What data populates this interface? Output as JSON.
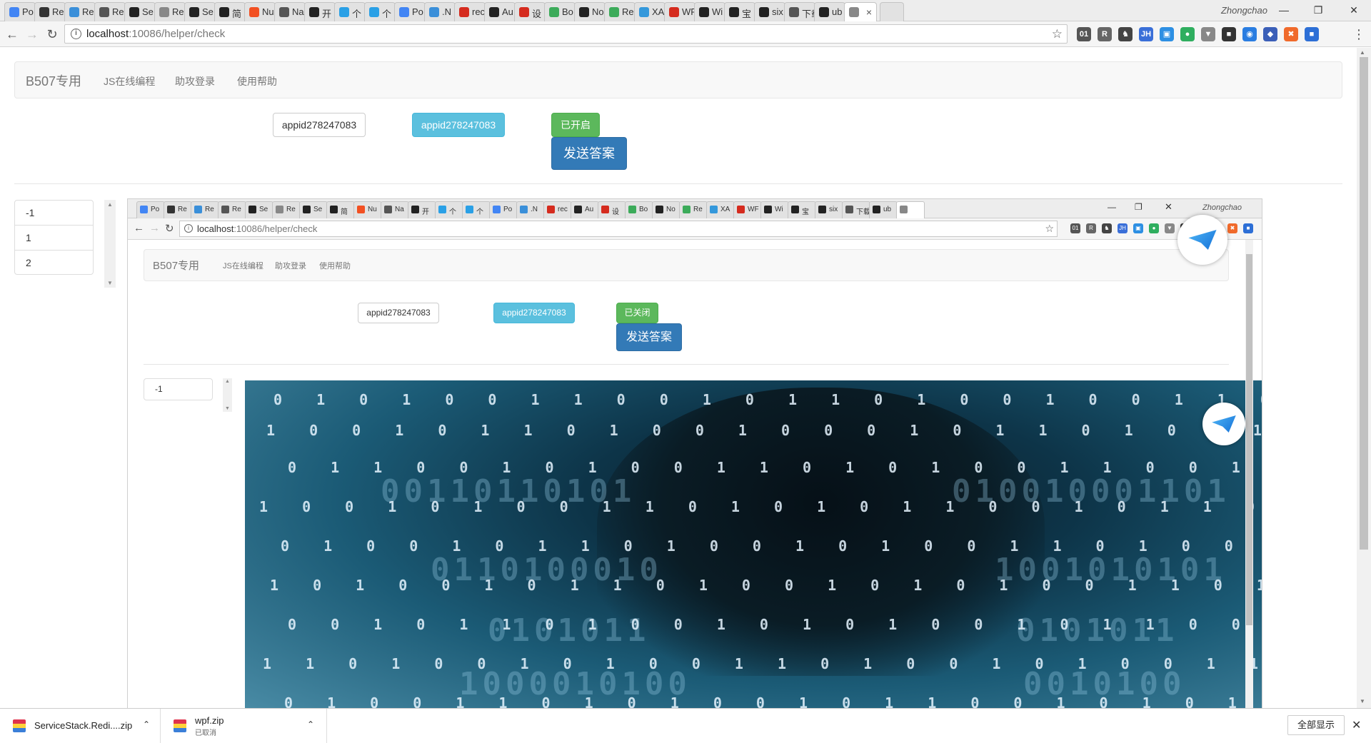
{
  "browser": {
    "tabs": [
      {
        "label": "Po",
        "icon": "google-icon",
        "color": "#4285f4"
      },
      {
        "label": "Re",
        "icon": "gamepad-icon",
        "color": "#333333"
      },
      {
        "label": "Re",
        "icon": "cloud-icon",
        "color": "#3a8fd9"
      },
      {
        "label": "Re",
        "icon": "translate-icon",
        "color": "#555555"
      },
      {
        "label": "Se",
        "icon": "github-icon",
        "color": "#222222"
      },
      {
        "label": "Re",
        "icon": "page-icon",
        "color": "#888888"
      },
      {
        "label": "Se",
        "icon": "github-icon",
        "color": "#222222"
      },
      {
        "label": "简",
        "icon": "jianshu-icon",
        "color": "#222222"
      },
      {
        "label": "Nu",
        "icon": "microsoft-icon",
        "color": "#f25022"
      },
      {
        "label": "Na",
        "icon": "translate-icon",
        "color": "#555555"
      },
      {
        "label": "开",
        "icon": "github-icon",
        "color": "#222222"
      },
      {
        "label": "个",
        "icon": "play-icon",
        "color": "#2aa0e6"
      },
      {
        "label": "个",
        "icon": "play-icon",
        "color": "#2aa0e6"
      },
      {
        "label": "Po",
        "icon": "google-icon",
        "color": "#4285f4"
      },
      {
        "label": ".N",
        "icon": "cloud-icon",
        "color": "#3a8fd9"
      },
      {
        "label": "rec",
        "icon": "csdn-icon",
        "color": "#d52b1e"
      },
      {
        "label": "Au",
        "icon": "github-icon",
        "color": "#222222"
      },
      {
        "label": "设",
        "icon": "csdn-icon",
        "color": "#d52b1e"
      },
      {
        "label": "Bo",
        "icon": "cnblogs-icon",
        "color": "#3cab5a"
      },
      {
        "label": "No",
        "icon": "github-icon",
        "color": "#222222"
      },
      {
        "label": "Re",
        "icon": "cnblogs-icon",
        "color": "#3cab5a"
      },
      {
        "label": "XA",
        "icon": "xamarin-icon",
        "color": "#3498db"
      },
      {
        "label": "WF",
        "icon": "csdn-icon",
        "color": "#d52b1e"
      },
      {
        "label": "Wi",
        "icon": "github-icon",
        "color": "#222222"
      },
      {
        "label": "宝",
        "icon": "bt-icon",
        "color": "#222222"
      },
      {
        "label": "six",
        "icon": "github-icon",
        "color": "#222222"
      },
      {
        "label": "下载",
        "icon": "download-icon",
        "color": "#555555"
      },
      {
        "label": "ub",
        "icon": "terminal-icon",
        "color": "#222222"
      },
      {
        "label": "",
        "icon": "page-icon",
        "color": "#888888",
        "active": true
      }
    ],
    "profile_name": "Zhongchao",
    "url_host": "localhost",
    "url_path": ":10086/helper/check",
    "extensions": [
      "01",
      "R",
      "♞",
      "JH",
      "▣",
      "●",
      "▼",
      "■",
      "◉",
      "◆",
      "✖",
      "■"
    ]
  },
  "page": {
    "brand": "B507专用",
    "nav_links": [
      "JS在线编程",
      "助攻登录",
      "使用帮助"
    ],
    "appid_input": "appid278247083",
    "appid_button": "appid278247083",
    "status_button": "已开启",
    "send_button": "发送答案",
    "list_items": [
      "-1",
      "1",
      "2"
    ]
  },
  "inner": {
    "profile_name": "Zhongchao",
    "url_host": "localhost",
    "url_path": ":10086/helper/check",
    "brand": "B507专用",
    "nav_links": [
      "JS在线编程",
      "助攻登录",
      "使用帮助"
    ],
    "appid_input": "appid278247083",
    "appid_button": "appid278247083",
    "status_button": "已关闭",
    "send_button": "发送答案",
    "list_items": [
      "-1"
    ]
  },
  "downloads": {
    "items": [
      {
        "name": "ServiceStack.Redi....zip",
        "status": ""
      },
      {
        "name": "wpf.zip",
        "status": "已取消"
      }
    ],
    "show_all": "全部显示"
  }
}
